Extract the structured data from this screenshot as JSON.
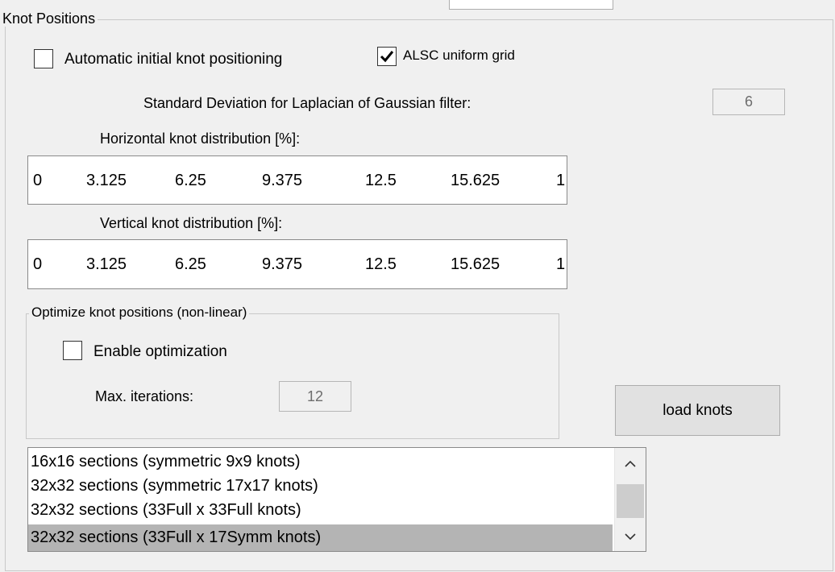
{
  "knot_positions": {
    "group_label": "Knot Positions",
    "auto_initial": {
      "label": "Automatic initial knot positioning",
      "checked": false
    },
    "alsc_uniform": {
      "label": "ALSC uniform grid",
      "checked": true
    },
    "std_dev": {
      "label": "Standard Deviation for Laplacian of Gaussian filter:",
      "value": "6"
    },
    "horizontal": {
      "label": "Horizontal knot distribution [%]:",
      "values": [
        "0",
        "3.125",
        "6.25",
        "9.375",
        "12.5",
        "15.625",
        "1"
      ]
    },
    "vertical": {
      "label": "Vertical knot distribution [%]:",
      "values": [
        "0",
        "3.125",
        "6.25",
        "9.375",
        "12.5",
        "15.625",
        "1"
      ]
    }
  },
  "optimize": {
    "group_label": "Optimize knot positions (non-linear)",
    "enable": {
      "label": "Enable optimization",
      "checked": false
    },
    "max_iterations": {
      "label": "Max. iterations:",
      "value": "12"
    }
  },
  "load_knots_button": "load knots",
  "sections_list": {
    "items": [
      "16x16 sections (symmetric 9x9 knots)",
      "32x32 sections (symmetric 17x17 knots)",
      "32x32 sections (33Full x 33Full knots)",
      "32x32 sections (33Full x 17Symm knots)"
    ],
    "selected_index": 3
  }
}
